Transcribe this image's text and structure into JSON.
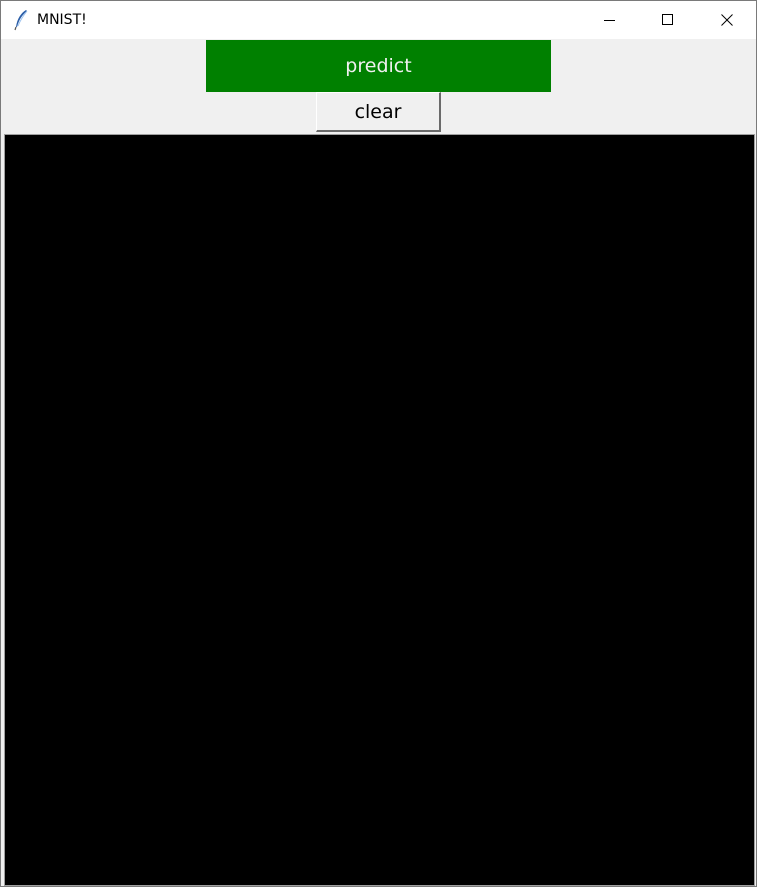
{
  "window": {
    "title": "MNIST!",
    "icon": "tk-feather-icon",
    "controls": {
      "minimize_icon": "minimize-icon",
      "maximize_icon": "maximize-icon",
      "close_icon": "close-icon"
    }
  },
  "toolbar": {
    "predict_label": "predict",
    "clear_label": "clear"
  },
  "canvas": {
    "background": "#000000"
  },
  "colors": {
    "predict_bg": "#008000",
    "predict_fg": "#f0f0f0",
    "window_bg": "#f0f0f0"
  }
}
